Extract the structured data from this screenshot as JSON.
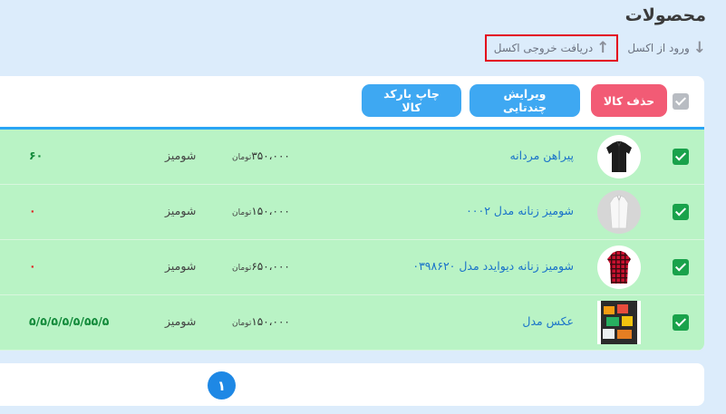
{
  "header": {
    "title": "محصولات",
    "import_label": "ورود از اکسل",
    "export_label": "دریافت خروجی اکسل"
  },
  "toolbar": {
    "delete_label": "حذف کالا",
    "bulk_edit_label": "ویرایش چندتایی",
    "barcode_label": "چاپ بارکد کالا"
  },
  "products": [
    {
      "name": "پیراهن مردانه",
      "price": "۳۵۰،۰۰۰",
      "currency": "تومان",
      "category": "شومیز",
      "stock": "۶۰",
      "stock_color": "#128a3a"
    },
    {
      "name": "شومیز زنانه مدل ۰۰۰۲",
      "price": "۱۵۰،۰۰۰",
      "currency": "تومان",
      "category": "شومیز",
      "stock": "۰",
      "stock_color": "#e02020"
    },
    {
      "name": "شومیز زنانه دیوایدد مدل ۰۳۹۸۶۲۰",
      "price": "۶۵۰،۰۰۰",
      "currency": "تومان",
      "category": "شومیز",
      "stock": "۰",
      "stock_color": "#e02020"
    },
    {
      "name": "عکس مدل",
      "price": "۱۵۰،۰۰۰",
      "currency": "تومان",
      "category": "شومیز",
      "stock": "۵/۵/۵/۵/۵/۵۵/۵",
      "stock_color": "#128a3a"
    }
  ],
  "pagination": {
    "current": "۱"
  },
  "colors": {
    "row_bg": "#b9f3c5",
    "accent": "#2aa5f5",
    "danger": "#f25b75",
    "checkbox": "#19a24b",
    "highlight_box": "#e3001b"
  }
}
